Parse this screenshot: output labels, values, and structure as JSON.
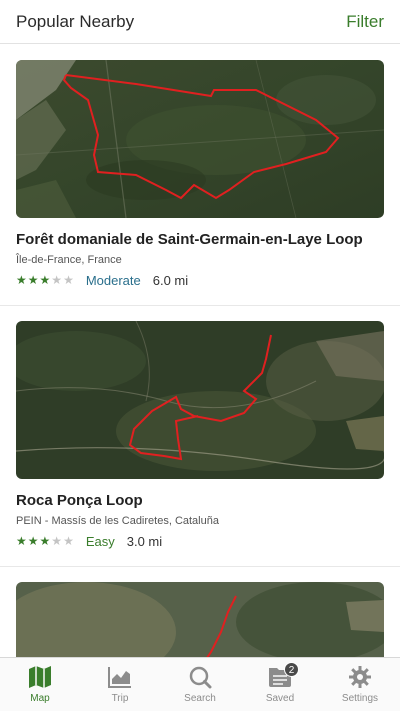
{
  "header": {
    "title": "Popular Nearby",
    "filter_label": "Filter"
  },
  "trails": [
    {
      "name": "Forêt domaniale de Saint-Germain-en-Laye Loop",
      "region": "Île-de-France, France",
      "rating": 3,
      "rating_max": 5,
      "difficulty": "Moderate",
      "distance": "6.0 mi"
    },
    {
      "name": "Roca Ponça Loop",
      "region": "PEIN - Massís de les Cadiretes, Cataluña",
      "rating": 3,
      "rating_max": 5,
      "difficulty": "Easy",
      "distance": "3.0 mi"
    },
    {
      "name": "",
      "region": "",
      "difficulty": "",
      "distance": ""
    }
  ],
  "tabs": [
    {
      "label": "Map",
      "icon": "map-icon",
      "active": true
    },
    {
      "label": "Trip",
      "icon": "chart-icon",
      "active": false
    },
    {
      "label": "Search",
      "icon": "search-icon",
      "active": false
    },
    {
      "label": "Saved",
      "icon": "saved-list-icon",
      "active": false,
      "badge": "2"
    },
    {
      "label": "Settings",
      "icon": "gear-icon",
      "active": false
    }
  ],
  "colors": {
    "accent": "#3a7d2c",
    "moderate": "#2a6f8c",
    "route": "#e02020",
    "star_off": "#c4c4c4"
  }
}
